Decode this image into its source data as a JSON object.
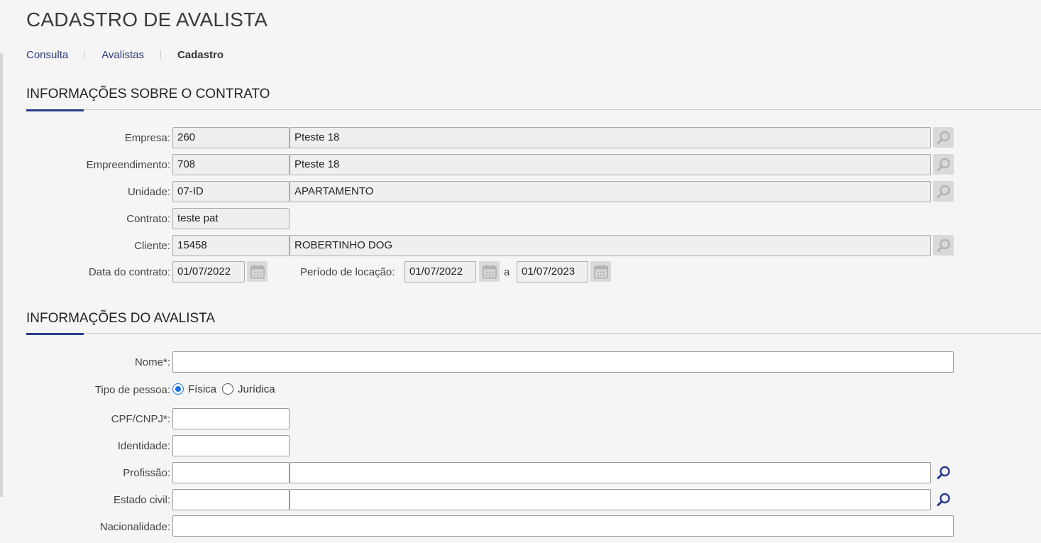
{
  "page": {
    "title": "CADASTRO DE AVALISTA"
  },
  "breadcrumb": {
    "consulta": "Consulta",
    "avalistas": "Avalistas",
    "cadastro": "Cadastro"
  },
  "contract_section": {
    "title": "INFORMAÇÕES SOBRE O CONTRATO",
    "empresa": {
      "label": "Empresa:",
      "code": "260",
      "name": "Pteste 18"
    },
    "empreendimento": {
      "label": "Empreendimento:",
      "code": "708",
      "name": "Pteste 18"
    },
    "unidade": {
      "label": "Unidade:",
      "code": "07-ID",
      "name": "APARTAMENTO"
    },
    "contrato": {
      "label": "Contrato:",
      "value": "teste pat"
    },
    "cliente": {
      "label": "Cliente:",
      "code": "15458",
      "name": "ROBERTINHO DOG"
    },
    "data_contrato": {
      "label": "Data do contrato:",
      "value": "01/07/2022"
    },
    "periodo_locacao": {
      "label": "Período de locação:",
      "start": "01/07/2022",
      "separator": "a",
      "end": "01/07/2023"
    }
  },
  "guarantor_section": {
    "title": "INFORMAÇÕES DO AVALISTA",
    "nome": {
      "label": "Nome*:",
      "value": ""
    },
    "tipo_pessoa": {
      "label": "Tipo de pessoa:",
      "options": [
        "Física",
        "Jurídica"
      ],
      "selected": "Física"
    },
    "cpf_cnpj": {
      "label": "CPF/CNPJ*:",
      "value": ""
    },
    "identidade": {
      "label": "Identidade:",
      "value": ""
    },
    "profissao": {
      "label": "Profissão:",
      "code": "",
      "name": ""
    },
    "estado_civil": {
      "label": "Estado civil:",
      "code": "",
      "name": ""
    },
    "nacionalidade": {
      "label": "Nacionalidade:",
      "value": ""
    }
  },
  "icons": {
    "lookup": "magnifier-icon",
    "date": "calendar-icon"
  },
  "colors": {
    "accent": "#2b3a8f",
    "link": "#2d3a7a",
    "radio": "#1a73e8",
    "disabled_button": "#d9d9d9",
    "readonly_field": "#efefef"
  }
}
